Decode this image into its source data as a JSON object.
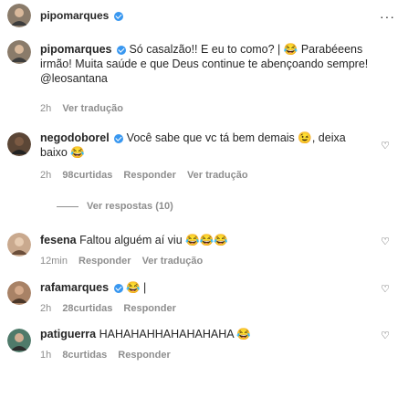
{
  "post_header": {
    "username": "pipomarques",
    "more_icon": "ellipsis-icon"
  },
  "caption": {
    "username": "pipomarques",
    "text": "Só casalzão!! E eu to como? | 😂 Parabéeens irmão! Muita saúde e que Deus continue te abençoando sempre! @leosantana",
    "time": "2h",
    "translate": "Ver tradução"
  },
  "comments": [
    {
      "username": "negodoborel",
      "verified": true,
      "text": "Você sabe que vc tá bem demais 😉, deixa baixo 😂",
      "time": "2h",
      "likes": "98curtidas",
      "reply": "Responder",
      "translate": "Ver tradução"
    },
    {
      "username": "fesena",
      "verified": false,
      "text": "Faltou alguém aí viu 😂😂😂",
      "time": "12min",
      "reply": "Responder",
      "translate": "Ver tradução"
    },
    {
      "username": "rafamarques",
      "verified": true,
      "text": "😂 |",
      "time": "2h",
      "likes": "28curtidas",
      "reply": "Responder"
    },
    {
      "username": "patiguerra",
      "verified": false,
      "text": "HAHAHAHHAHAHAHAHA 😂",
      "time": "1h",
      "likes": "8curtidas",
      "reply": "Responder"
    }
  ],
  "view_replies": "Ver respostas (10)",
  "colors": {
    "text": "#262626",
    "meta": "#8e8e8e",
    "verified": "#3897f0"
  }
}
